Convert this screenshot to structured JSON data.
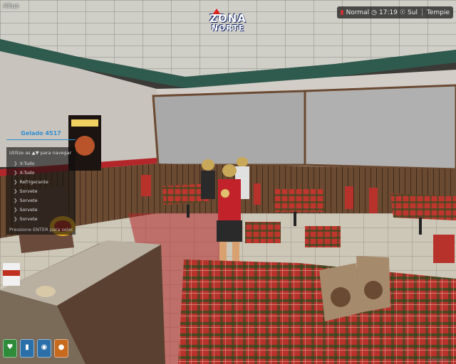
{
  "hud": {
    "top_left": "Altus"
  },
  "logo": {
    "line1": "ZONA",
    "line2": "NORTE"
  },
  "status": {
    "mode": "Normal",
    "time": "17:19",
    "direction": "Sul",
    "location": "Tempie"
  },
  "menu": {
    "title": "Gelado 4517",
    "hint": "Utilize as ▲▼ para navegar",
    "items": [
      "X-Tudo",
      "X-Tudo",
      "Refrigerante",
      "Sorvete",
      "Sorvete",
      "Sorvete",
      "Sorvete"
    ],
    "footer": "Pressione ENTER para selec"
  },
  "needs": [
    {
      "icon": "heart-icon",
      "color": "#2e8b3a"
    },
    {
      "icon": "armor-icon",
      "color": "#2a6fa8"
    },
    {
      "icon": "water-drop-icon",
      "color": "#2a6fa8"
    },
    {
      "icon": "food-icon",
      "color": "#c86a1e"
    }
  ],
  "watermark": "N76A4 K-1"
}
